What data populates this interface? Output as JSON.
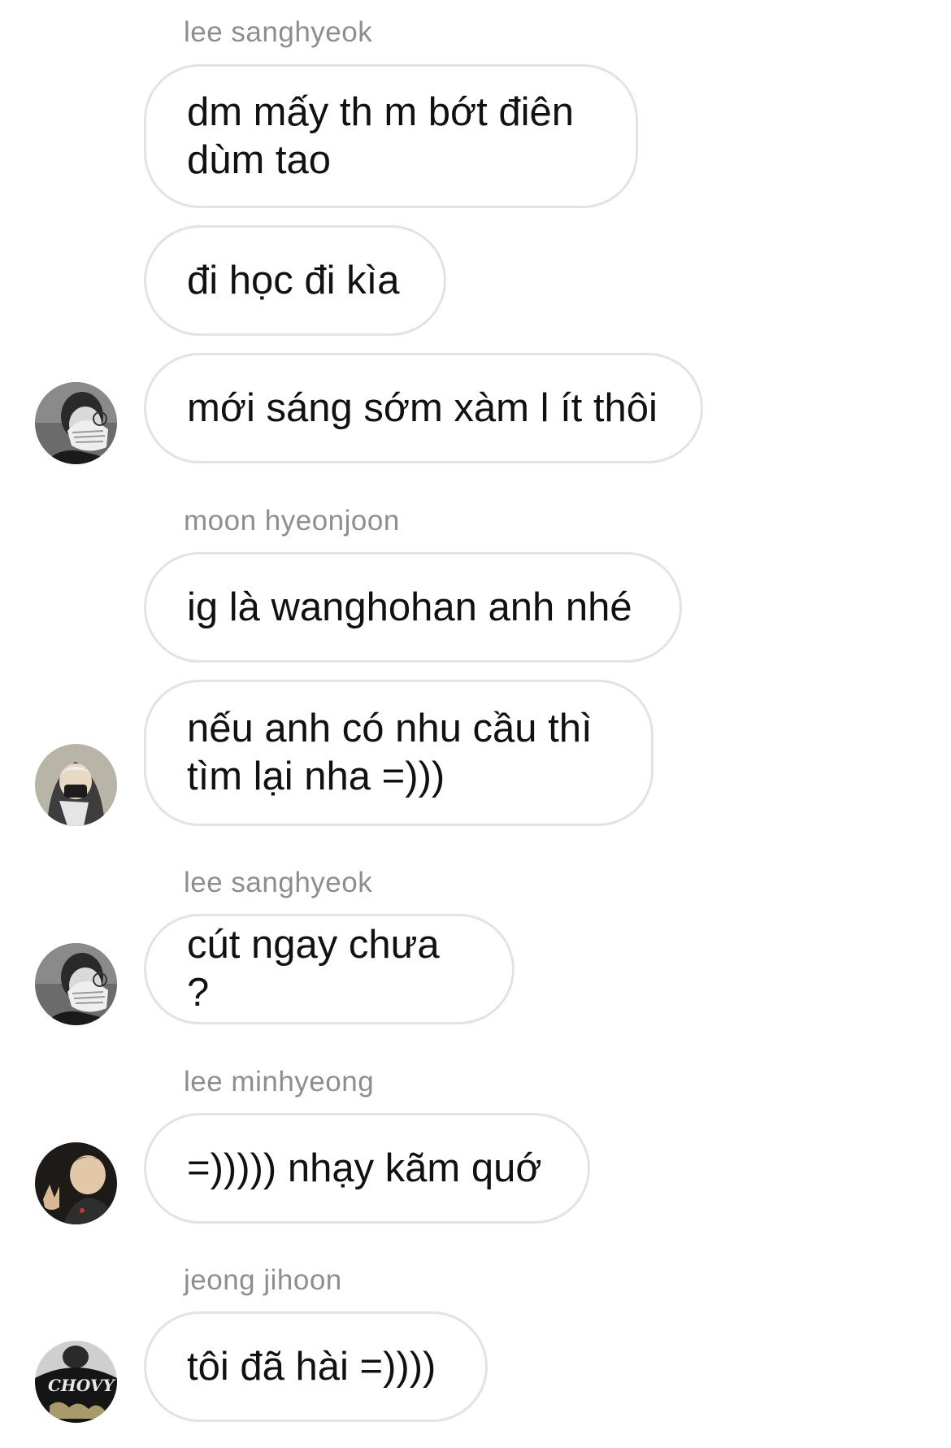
{
  "conversation": {
    "groups": [
      {
        "sender": "lee sanghyeok",
        "messages": [
          "dm mấy th m bớt điên\ndùm tao",
          "đi học đi kìa",
          "mới sáng sớm xàm l ít thôi"
        ],
        "avatar_icon": "avatar-photo-hand-glasses"
      },
      {
        "sender": "moon hyeonjoon",
        "messages": [
          "ig là wanghohan anh nhé",
          "nếu anh có nhu cầu thì\ntìm lại nha =)))"
        ],
        "avatar_icon": "avatar-photo-hoodie"
      },
      {
        "sender": "lee sanghyeok",
        "messages": [
          "cút ngay chưa ?"
        ],
        "avatar_icon": "avatar-photo-hand-glasses"
      },
      {
        "sender": "lee minhyeong",
        "messages": [
          "=))))) nhạy kãm quớ"
        ],
        "avatar_icon": "avatar-photo-selfie"
      },
      {
        "sender": "jeong jihoon",
        "messages": [
          "tôi đã hài =))))"
        ],
        "avatar_icon": "avatar-photo-chovy-shirt",
        "avatar_text": "CHOVY"
      }
    ]
  },
  "colors": {
    "sender_name": "#8e8e8e",
    "bubble_border": "#e3e3e3",
    "message_text": "#111111",
    "background": "#ffffff"
  }
}
